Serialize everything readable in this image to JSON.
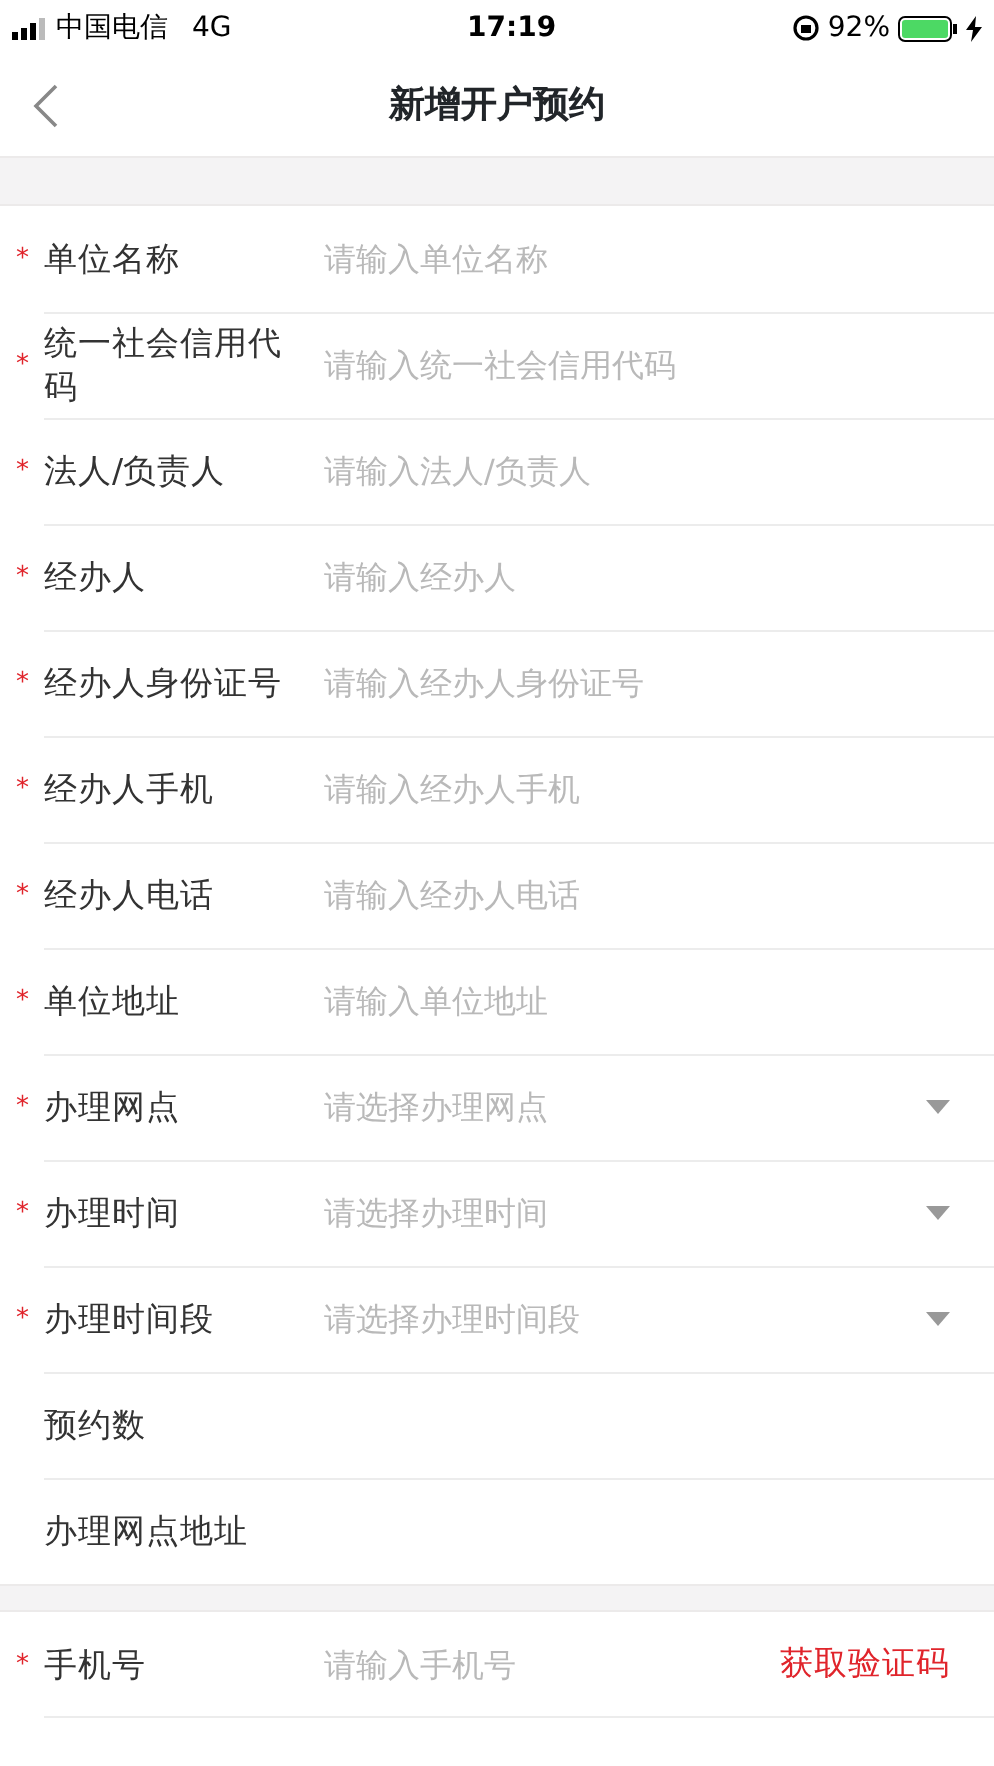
{
  "status_bar": {
    "carrier": "中国电信",
    "network": "4G",
    "time": "17:19",
    "battery_text": "92%"
  },
  "nav": {
    "title": "新增开户预约"
  },
  "sections": [
    {
      "rows": [
        {
          "kind": "input",
          "required_mark": "*",
          "label": "单位名称",
          "placeholder": "请输入单位名称"
        },
        {
          "kind": "input",
          "required_mark": "*",
          "label": "统一社会信用代码",
          "placeholder": "请输入统一社会信用代码"
        },
        {
          "kind": "input",
          "required_mark": "*",
          "label": "法人/负责人",
          "placeholder": "请输入法人/负责人"
        },
        {
          "kind": "input",
          "required_mark": "*",
          "label": "经办人",
          "placeholder": "请输入经办人"
        },
        {
          "kind": "input",
          "required_mark": "*",
          "label": "经办人身份证号",
          "placeholder": "请输入经办人身份证号"
        },
        {
          "kind": "input",
          "required_mark": "*",
          "label": "经办人手机",
          "placeholder": "请输入经办人手机"
        },
        {
          "kind": "input",
          "required_mark": "*",
          "label": "经办人电话",
          "placeholder": "请输入经办人电话"
        },
        {
          "kind": "input",
          "required_mark": "*",
          "label": "单位地址",
          "placeholder": "请输入单位地址"
        },
        {
          "kind": "select",
          "required_mark": "*",
          "label": "办理网点",
          "placeholder": "请选择办理网点"
        },
        {
          "kind": "select",
          "required_mark": "*",
          "label": "办理时间",
          "placeholder": "请选择办理时间"
        },
        {
          "kind": "select",
          "required_mark": "*",
          "label": "办理时间段",
          "placeholder": "请选择办理时间段"
        },
        {
          "kind": "display",
          "label": "预约数"
        },
        {
          "kind": "display",
          "label": "办理网点地址"
        }
      ]
    },
    {
      "rows": [
        {
          "kind": "action",
          "required_mark": "*",
          "label": "手机号",
          "placeholder": "请输入手机号",
          "action": "获取验证码"
        }
      ]
    }
  ]
}
